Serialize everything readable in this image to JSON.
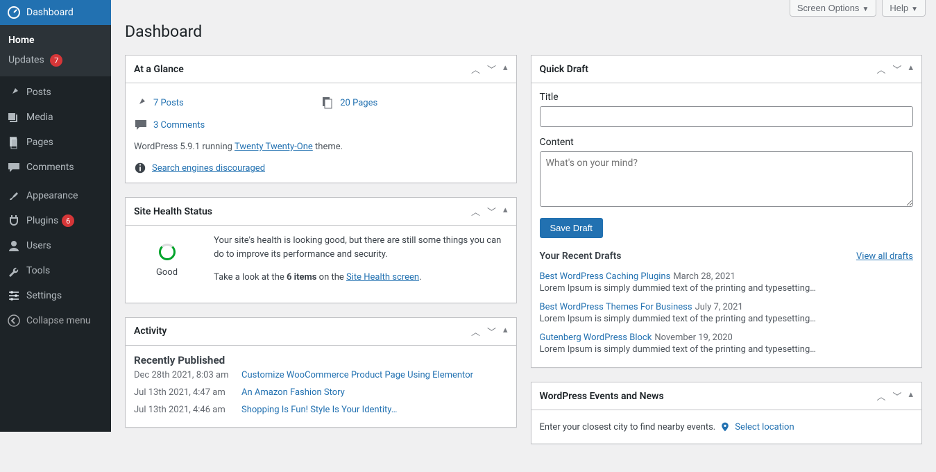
{
  "top": {
    "screen_options": "Screen Options",
    "help": "Help"
  },
  "page_title": "Dashboard",
  "sidebar": {
    "items": [
      {
        "label": "Dashboard",
        "icon": "dashboard",
        "active": true
      },
      {
        "label": "Posts",
        "icon": "pin"
      },
      {
        "label": "Media",
        "icon": "media"
      },
      {
        "label": "Pages",
        "icon": "page"
      },
      {
        "label": "Comments",
        "icon": "comment"
      },
      {
        "label": "Appearance",
        "icon": "brush"
      },
      {
        "label": "Plugins",
        "icon": "plug",
        "badge": "6"
      },
      {
        "label": "Users",
        "icon": "user"
      },
      {
        "label": "Tools",
        "icon": "wrench"
      },
      {
        "label": "Settings",
        "icon": "sliders"
      },
      {
        "label": "Collapse menu",
        "icon": "collapse"
      }
    ],
    "submenu": {
      "home": "Home",
      "updates": "Updates",
      "updates_badge": "7"
    }
  },
  "glance": {
    "title": "At a Glance",
    "posts": "7 Posts",
    "pages": "20 Pages",
    "comments": "3 Comments",
    "version_prefix": "WordPress 5.9.1 running ",
    "theme": "Twenty Twenty-One",
    "version_suffix": " theme.",
    "discouraged": "Search engines discouraged"
  },
  "health": {
    "title": "Site Health Status",
    "status": "Good",
    "text1": "Your site's health is looking good, but there are still some things you can do to improve its performance and security.",
    "text2a": "Take a look at the ",
    "text2b": "6 items",
    "text2c": " on the ",
    "text2link": "Site Health screen",
    "text2d": "."
  },
  "activity": {
    "title": "Activity",
    "section": "Recently Published",
    "rows": [
      {
        "date": "Dec 28th 2021, 8:03 am",
        "title": "Customize WooCommerce Product Page Using Elementor"
      },
      {
        "date": "Jul 13th 2021, 4:47 am",
        "title": "An Amazon Fashion Story"
      },
      {
        "date": "Jul 13th 2021, 4:46 am",
        "title": "Shopping Is Fun! Style Is Your Identity…"
      }
    ]
  },
  "quickdraft": {
    "title": "Quick Draft",
    "title_label": "Title",
    "content_label": "Content",
    "content_placeholder": "What's on your mind?",
    "save": "Save Draft",
    "recent_header": "Your Recent Drafts",
    "view_all": "View all drafts",
    "drafts": [
      {
        "title": "Best WordPress Caching Plugins",
        "date": "March 28, 2021",
        "excerpt": "Lorem Ipsum is simply dummied text of the printing and typesetting…"
      },
      {
        "title": "Best WordPress Themes For Business",
        "date": "July 7, 2021",
        "excerpt": "Lorem Ipsum is simply dummied text of the printing and typesetting…"
      },
      {
        "title": "Gutenberg WordPress Block",
        "date": "November 19, 2020",
        "excerpt": "Lorem Ipsum is simply dummied text of the printing and typesetting…"
      }
    ]
  },
  "events": {
    "title": "WordPress Events and News",
    "city_text": "Enter your closest city to find nearby events.",
    "select_location": "Select location"
  }
}
